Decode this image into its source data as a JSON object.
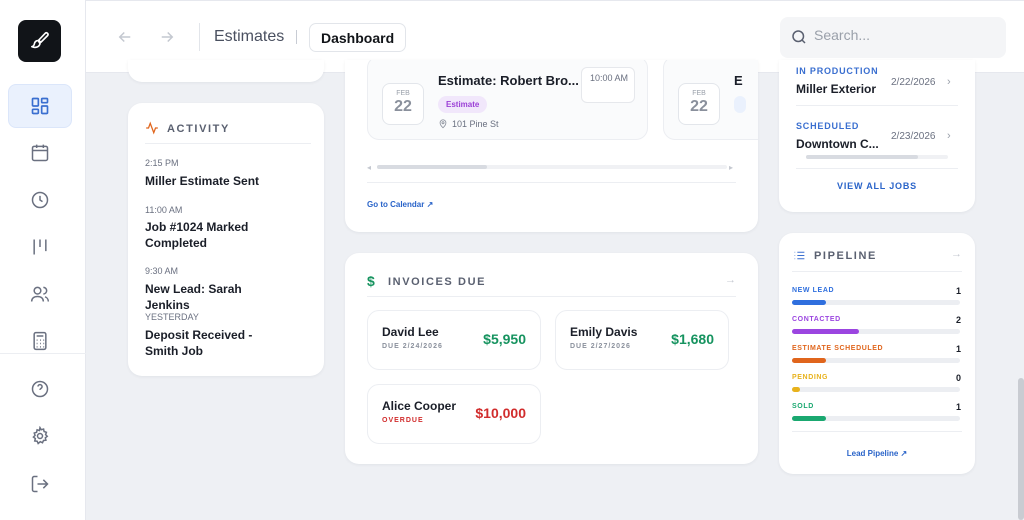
{
  "header": {
    "breadcrumb": "Estimates",
    "active_tab": "Dashboard",
    "search_placeholder": "Search..."
  },
  "activity": {
    "title": "ACTIVITY",
    "items": [
      {
        "time": "2:15 PM",
        "title": "Miller Estimate Sent"
      },
      {
        "time": "11:00 AM",
        "title": "Job #1024 Marked Completed"
      },
      {
        "time": "9:30 AM",
        "title": "New Lead: Sarah Jenkins"
      },
      {
        "time": "YESTERDAY",
        "title": "Deposit Received - Smith Job"
      }
    ]
  },
  "estimates": {
    "card1": {
      "month": "FEB",
      "day": "22",
      "title": "Estimate: Robert Bro...",
      "tag": "Estimate",
      "address": "101 Pine St",
      "time": "10:00 AM"
    },
    "card2": {
      "month": "FEB",
      "day": "22",
      "title": "E"
    },
    "calendar_link": "Go to Calendar"
  },
  "invoices": {
    "title": "INVOICES DUE",
    "items": [
      {
        "name": "David Lee",
        "due": "DUE 2/24/2026",
        "amount": "$5,950",
        "amount_color": "#16935f"
      },
      {
        "name": "Emily Davis",
        "due": "DUE 2/27/2026",
        "amount": "$1,680",
        "amount_color": "#16935f"
      },
      {
        "name": "Alice Cooper",
        "due": "OVERDUE",
        "amount": "$10,000",
        "amount_color": "#d12c2c"
      }
    ]
  },
  "jobs": {
    "items": [
      {
        "status": "IN PRODUCTION",
        "name": "Miller Exterior",
        "date": "2/22/2026"
      },
      {
        "status": "SCHEDULED",
        "name": "Downtown C...",
        "date": "2/23/2026"
      }
    ],
    "view_all": "VIEW ALL JOBS"
  },
  "pipeline": {
    "title": "PIPELINE",
    "stages": [
      {
        "label": "NEW LEAD",
        "count": "1",
        "fraction": 0.2,
        "color": "#2f6fde"
      },
      {
        "label": "CONTACTED",
        "count": "2",
        "fraction": 0.4,
        "color": "#9b45e0"
      },
      {
        "label": "ESTIMATE SCHEDULED",
        "count": "1",
        "fraction": 0.2,
        "color": "#e0651c"
      },
      {
        "label": "PENDING",
        "count": "0",
        "fraction": 0.05,
        "color": "#e8b21c"
      },
      {
        "label": "SOLD",
        "count": "1",
        "fraction": 0.2,
        "color": "#1aa870"
      }
    ],
    "link": "Lead Pipeline"
  },
  "colors": {
    "accent": "#2a64c9",
    "logo_bg": "#111418"
  }
}
